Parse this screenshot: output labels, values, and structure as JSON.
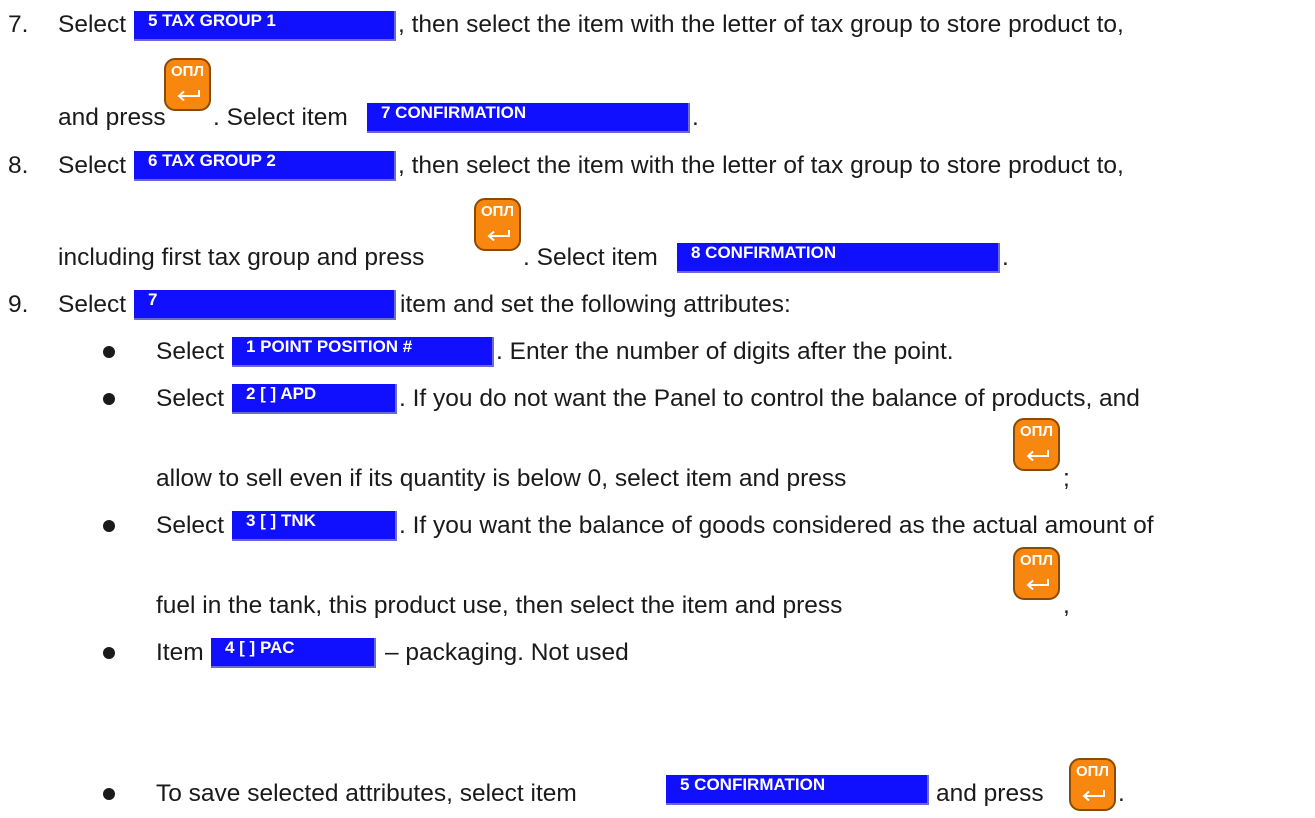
{
  "steps": {
    "s7": {
      "number": "7.",
      "select": "Select",
      "button": "5 TAX GROUP 1",
      "text_a": ", then select the item with the letter of tax group to store product to,",
      "text_b": "and press",
      "text_c": ". Select item",
      "confirm_button": "7 CONFIRMATION",
      "end": "."
    },
    "s8": {
      "number": "8.",
      "select": "Select",
      "button": "6 TAX GROUP 2",
      "text_a": ", then select the item with the letter of tax group to store product to,",
      "text_b": "including first tax group and press",
      "text_c": ". Select item",
      "confirm_button": "8 CONFIRMATION",
      "end": "."
    },
    "s9": {
      "number": "9.",
      "select": "Select",
      "button": "7",
      "text_a": "item and set the following attributes:"
    }
  },
  "bullets": {
    "b1": {
      "select": "Select",
      "button": "1 POINT POSITION #",
      "text": ". Enter the number of digits after the point."
    },
    "b2": {
      "select": "Select",
      "button": "2 [   ] APD",
      "text_a": ". If you do not want the Panel to control the balance of products, and",
      "text_b": "allow to sell even if its quantity is below 0, select item and press",
      "end": ";"
    },
    "b3": {
      "select": "Select",
      "button": "3 [   ] TNK",
      "text_a": ". If you want the balance of goods considered as the actual amount of",
      "text_b": "fuel in the tank, this product use, then select the item and press",
      "end": ","
    },
    "b4": {
      "item": "Item",
      "button": "4 [   ] PAC",
      "text": "– packaging. Not used"
    },
    "b5": {
      "text_a": "To save selected attributes, select item",
      "button": "5 CONFIRMATION",
      "text_b": "and press",
      "end": "."
    }
  },
  "enter_key": {
    "label": "ОПЛ",
    "icon": "enter-arrow-icon",
    "color": "#f7870f"
  },
  "colors": {
    "button_bg": "#1010ff",
    "button_text": "#ffffff",
    "text": "#1a1a1a"
  }
}
